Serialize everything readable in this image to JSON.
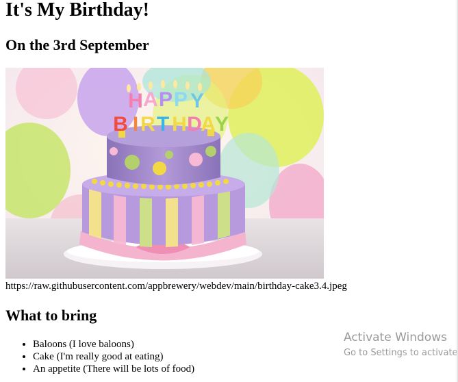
{
  "page": {
    "title": "It's My Birthday!",
    "subtitle": "On the 3rd September"
  },
  "cake_image": {
    "caption": "https://raw.githubusercontent.com/appbrewery/webdev/main/birthday-cake3.4.jpeg",
    "candle_letters": "HAPPY BIRTHDAY"
  },
  "bring": {
    "heading": "What to bring",
    "items": [
      "Baloons (I love baloons)",
      "Cake (I'm really good at eating)",
      "An appetite (There will be lots of food)"
    ]
  },
  "watermark": {
    "title": "Activate Windows",
    "subtitle": "Go to Settings to activate"
  }
}
